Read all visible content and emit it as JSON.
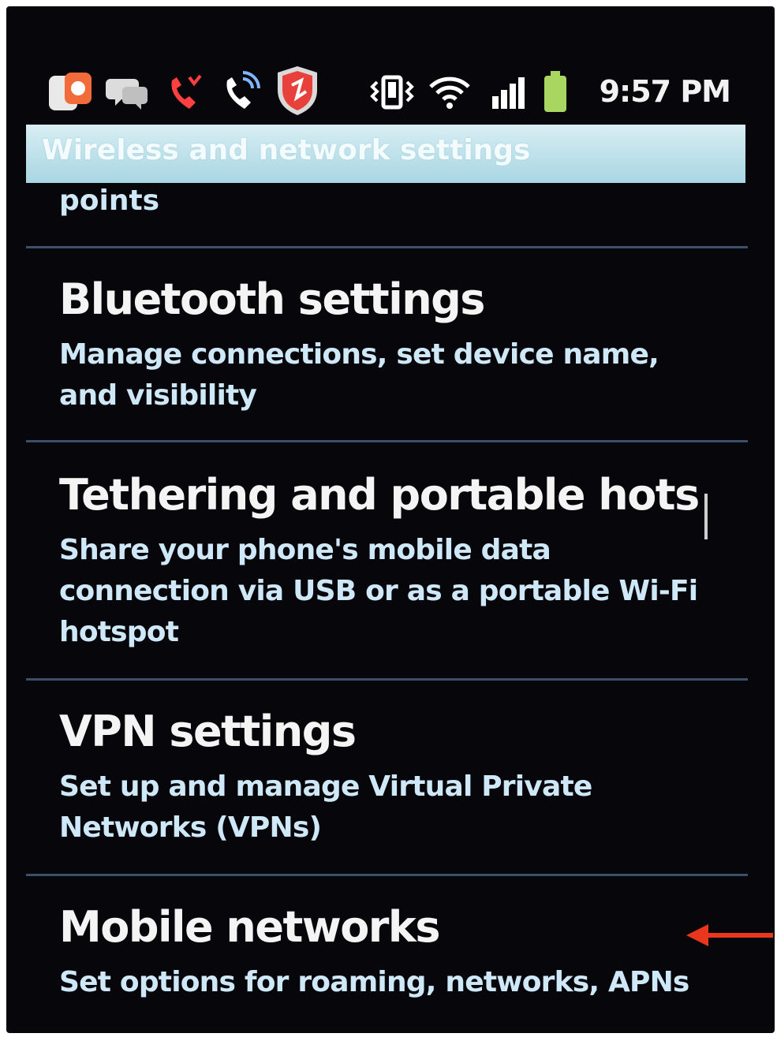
{
  "status_bar": {
    "time": "9:57 PM",
    "icons": [
      "notification-app-icon",
      "chat-icon",
      "missed-call-icon",
      "call-icon",
      "security-shield-icon",
      "vibrate-icon",
      "wifi-icon",
      "signal-icon",
      "battery-icon"
    ]
  },
  "header": {
    "title": "Wireless and network settings"
  },
  "list": {
    "partial_summary": "points",
    "items": [
      {
        "title": "Bluetooth settings",
        "summary": "Manage connections, set device name, and visibility"
      },
      {
        "title": "Tethering and portable hots",
        "summary": "Share your phone's mobile data connection via USB or as a portable Wi-Fi hotspot"
      },
      {
        "title": "VPN settings",
        "summary": "Set up and manage Virtual Private Networks (VPNs)"
      },
      {
        "title": "Mobile networks",
        "summary": "Set options for roaming, networks, APNs"
      }
    ]
  },
  "colors": {
    "background": "#07070b",
    "title_bar": "#c2e3ec",
    "divider": "#3c4f6e",
    "item_title": "#f4f4f4",
    "item_summary": "#cfe8f8",
    "annotation_arrow": "#e8371c"
  }
}
